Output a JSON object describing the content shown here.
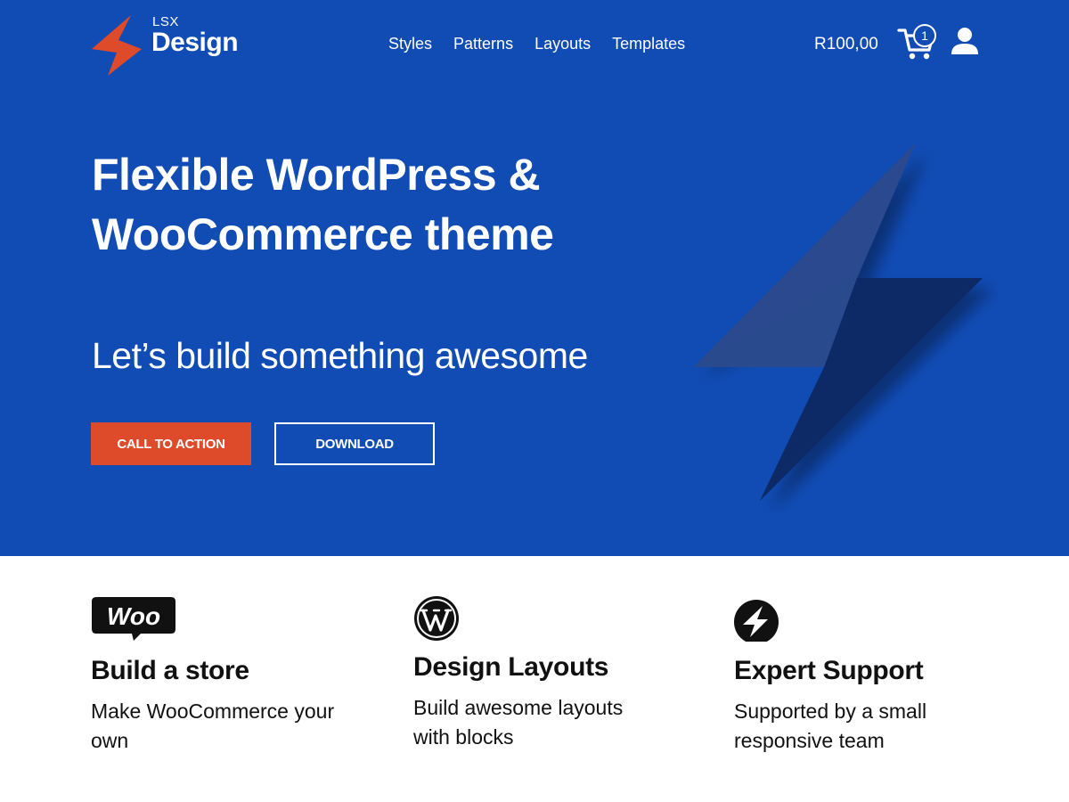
{
  "header": {
    "logo_small": "LSX",
    "logo_big": "Design",
    "nav": [
      "Styles",
      "Patterns",
      "Layouts",
      "Templates"
    ],
    "cart_total": "R100,00",
    "cart_count": "1"
  },
  "hero": {
    "title": "Flexible WordPress & WooCommerce theme",
    "subtitle": "Let’s build something awesome",
    "primary_button": "CALL TO ACTION",
    "secondary_button": "DOWNLOAD"
  },
  "features": [
    {
      "icon": "woo-icon",
      "icon_text": "Woo",
      "title": "Build a store",
      "text": "Make WooCommerce your own"
    },
    {
      "icon": "wordpress-icon",
      "title": "Design Layouts",
      "text": "Build awesome layouts with blocks"
    },
    {
      "icon": "lightning-icon",
      "title": "Expert Support",
      "text": "Supported by a small responsive team"
    }
  ],
  "colors": {
    "hero_bg": "#114bb4",
    "accent": "#de4b2a",
    "bolt_light": "#2a4a8e",
    "bolt_dark": "#0c2b66"
  }
}
